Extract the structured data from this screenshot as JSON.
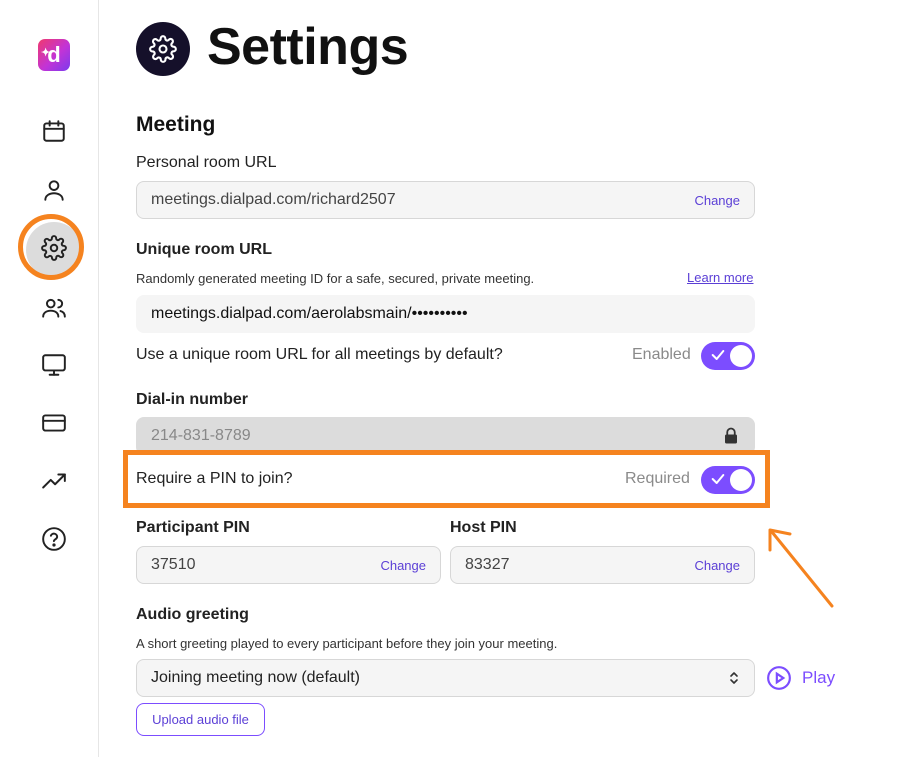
{
  "app": {
    "logo_letter": "d"
  },
  "sidebar": {
    "items": [
      {
        "icon": "calendar-icon"
      },
      {
        "icon": "user-icon"
      },
      {
        "icon": "gear-icon",
        "active": true
      },
      {
        "icon": "users-icon"
      },
      {
        "icon": "monitor-icon"
      },
      {
        "icon": "credit-card-icon"
      },
      {
        "icon": "trending-up-icon"
      },
      {
        "icon": "help-circle-icon"
      }
    ]
  },
  "header": {
    "title": "Settings",
    "icon": "gear-icon"
  },
  "meeting": {
    "section_title": "Meeting",
    "personal_room": {
      "label": "Personal room URL",
      "value": "meetings.dialpad.com/richard2507",
      "change_label": "Change"
    },
    "unique_room": {
      "label": "Unique room URL",
      "help": "Randomly generated meeting ID for a safe, secured, private meeting.",
      "learn_more": "Learn more",
      "value": "meetings.dialpad.com/aerolabsmain/••••••••••"
    },
    "unique_default": {
      "label": "Use a unique room URL for all meetings by default?",
      "status": "Enabled",
      "on": true
    },
    "dial_in": {
      "label": "Dial-in number",
      "value": "214-831-8789"
    },
    "require_pin": {
      "label": "Require a PIN to join?",
      "status": "Required",
      "on": true
    },
    "participant_pin": {
      "label": "Participant PIN",
      "value": "37510",
      "change_label": "Change"
    },
    "host_pin": {
      "label": "Host PIN",
      "value": "83327",
      "change_label": "Change"
    },
    "audio_greeting": {
      "label": "Audio greeting",
      "help": "A short greeting played to every participant before they join your meeting.",
      "selected": "Joining meeting now (default)",
      "play_label": "Play",
      "upload_label": "Upload audio file"
    }
  },
  "colors": {
    "accent": "#7c4dff",
    "highlight": "#f5831f",
    "dark": "#15102a"
  }
}
